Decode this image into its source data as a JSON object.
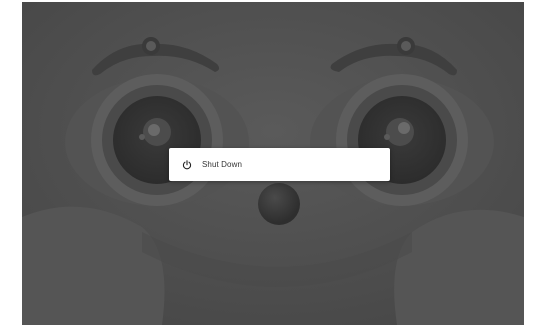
{
  "desktop": {
    "wallpaper": "cartoon-face-wallpaper",
    "background_color": "#4f4f4f"
  },
  "power_menu": {
    "items": [
      {
        "label": "Shut Down",
        "icon": "power-icon"
      }
    ]
  }
}
